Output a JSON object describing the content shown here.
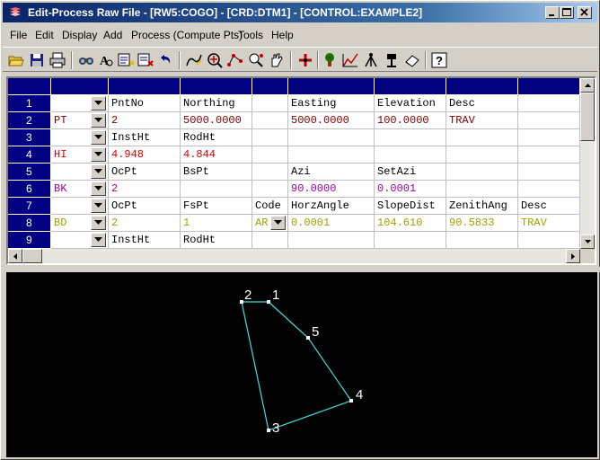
{
  "window": {
    "title": "Edit-Process Raw File - [RW5:COGO] - [CRD:DTM1] - [CONTROL:EXAMPLE2]"
  },
  "menu": [
    "File",
    "Edit",
    "Display",
    "Add",
    "Process (Compute Pts)",
    "Tools",
    "Help"
  ],
  "toolbar_icons": [
    "open-folder-icon",
    "save-icon",
    "print-icon",
    "find-icon",
    "find-text-icon",
    "insert-record-icon",
    "delete-record-icon",
    "undo-icon",
    "draw-line-icon",
    "zoom-icon",
    "points-icon",
    "magnifier-points-icon",
    "pan-hand-icon",
    "add-point-icon",
    "tree-icon",
    "graph-check-icon",
    "tripod-icon",
    "level-instrument-icon",
    "eraser-icon",
    "help-icon"
  ],
  "grid": {
    "header_cells": [
      "",
      "",
      "",
      "",
      "",
      "",
      "",
      "",
      "",
      ""
    ],
    "rows": [
      {
        "num": "1",
        "code": "",
        "code_color": "#000000",
        "has_subdrop": false,
        "cells": [
          "PntNo",
          "Northing",
          "",
          "Easting",
          "Elevation",
          "Desc",
          ""
        ],
        "value_color": "#000000"
      },
      {
        "num": "2",
        "code": "PT",
        "code_color": "#800000",
        "has_subdrop": false,
        "cells": [
          "2",
          "5000.0000",
          "",
          "5000.0000",
          "100.0000",
          "TRAV",
          ""
        ],
        "value_color": "#800000"
      },
      {
        "num": "3",
        "code": "",
        "code_color": "#000000",
        "has_subdrop": false,
        "cells": [
          "InstHt",
          "RodHt",
          "",
          "",
          "",
          "",
          ""
        ],
        "value_color": "#000000"
      },
      {
        "num": "4",
        "code": "HI",
        "code_color": "#e00000",
        "has_subdrop": false,
        "cells": [
          "4.948",
          "4.844",
          "",
          "",
          "",
          "",
          ""
        ],
        "value_color": "#e00000"
      },
      {
        "num": "5",
        "code": "",
        "code_color": "#000000",
        "has_subdrop": false,
        "cells": [
          "OcPt",
          "BsPt",
          "",
          "Azi",
          "SetAzi",
          "",
          ""
        ],
        "value_color": "#000000"
      },
      {
        "num": "6",
        "code": "BK",
        "code_color": "#a000a0",
        "has_subdrop": false,
        "cells": [
          "2",
          "",
          "",
          "90.0000",
          "0.0001",
          "",
          ""
        ],
        "value_color": "#a000a0"
      },
      {
        "num": "7",
        "code": "",
        "code_color": "#000000",
        "has_subdrop": false,
        "cells": [
          "OcPt",
          "FsPt",
          "Code",
          "HorzAngle",
          "SlopeDist",
          "ZenithAng",
          "Desc"
        ],
        "value_color": "#000000"
      },
      {
        "num": "8",
        "code": "BD",
        "code_color": "#a0a000",
        "has_subdrop": true,
        "cells": [
          "2",
          "1",
          "AR",
          "0.0001",
          "104.610",
          "90.5833",
          "TRAV"
        ],
        "value_color": "#a0a000"
      },
      {
        "num": "9",
        "code": "",
        "code_color": "#000000",
        "has_subdrop": false,
        "cells": [
          "InstHt",
          "RodHt",
          "",
          "",
          "",
          "",
          ""
        ],
        "value_color": "#000000"
      }
    ]
  },
  "plot": {
    "line_color": "#40e0e0",
    "points": [
      {
        "label": "1"
      },
      {
        "label": "2"
      },
      {
        "label": "3"
      },
      {
        "label": "4"
      },
      {
        "label": "5"
      }
    ]
  }
}
